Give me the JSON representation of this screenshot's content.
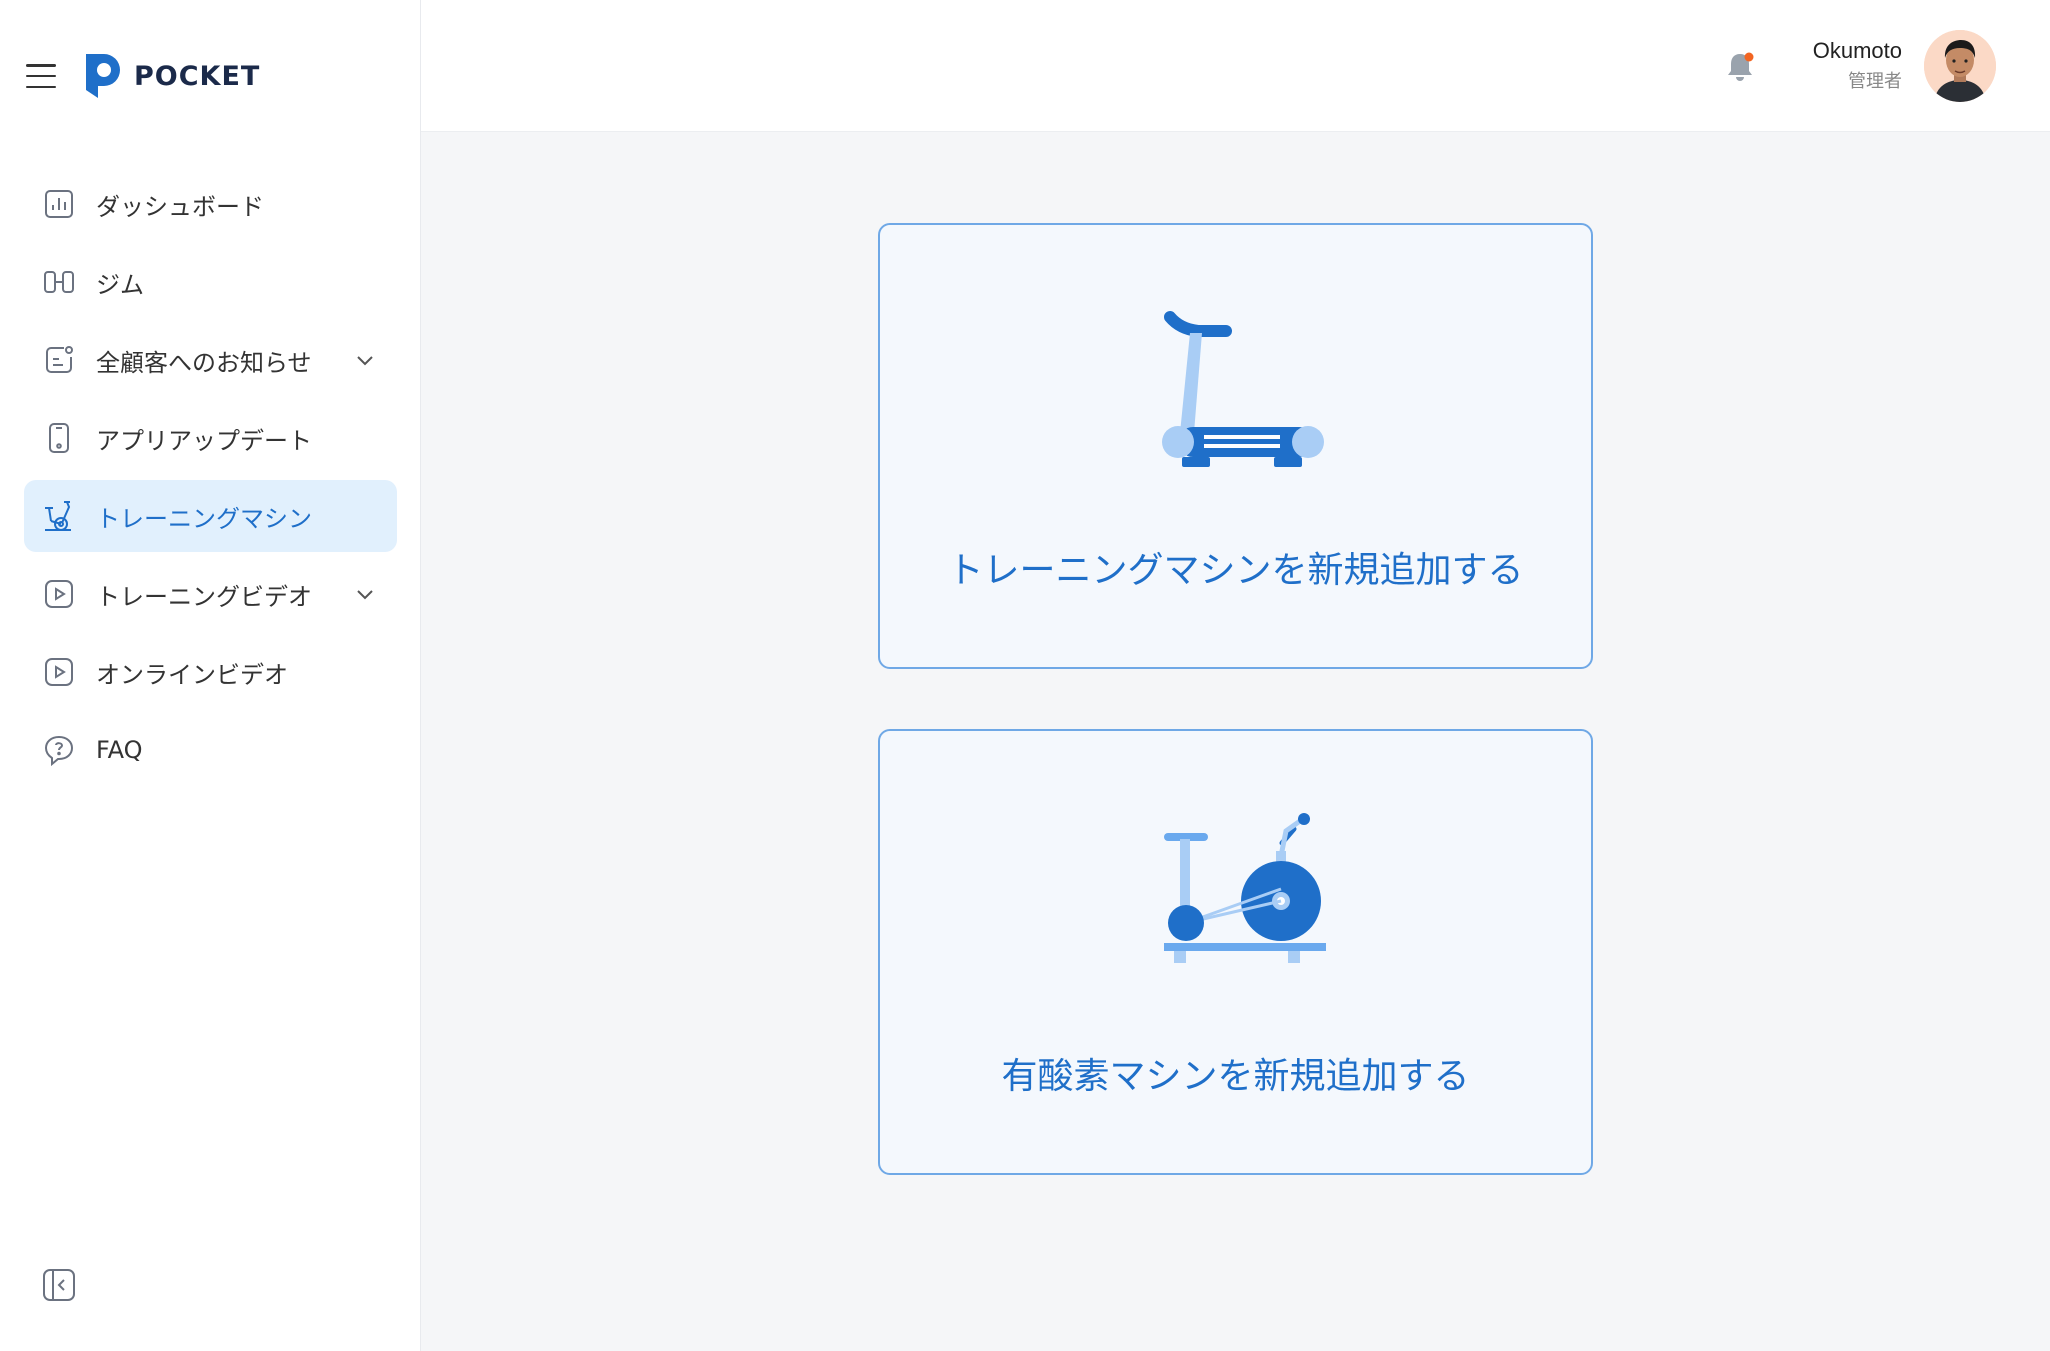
{
  "app": {
    "logo_text": "POCKET",
    "accent_color": "#1f6fc9"
  },
  "sidebar": {
    "items": [
      {
        "label": "ダッシュボード",
        "icon": "chart-icon"
      },
      {
        "label": "ジム",
        "icon": "gym-icon"
      },
      {
        "label": "全顧客へのお知らせ",
        "icon": "announcement-icon",
        "expandable": true
      },
      {
        "label": "アプリアップデート",
        "icon": "phone-icon"
      },
      {
        "label": "トレーニングマシン",
        "icon": "exercise-bike-icon",
        "active": true
      },
      {
        "label": "トレーニングビデオ",
        "icon": "video-icon",
        "expandable": true
      },
      {
        "label": "オンラインビデオ",
        "icon": "video-icon"
      },
      {
        "label": "FAQ",
        "icon": "faq-icon"
      }
    ],
    "collapse_icon": "collapse-sidebar-icon"
  },
  "header": {
    "notification_icon": "bell-icon",
    "user": {
      "name": "Okumoto",
      "role": "管理者"
    }
  },
  "main": {
    "cards": [
      {
        "label": "トレーニングマシンを新規追加する",
        "icon": "treadmill-icon"
      },
      {
        "label": "有酸素マシンを新規追加する",
        "icon": "exercise-bike-icon"
      }
    ]
  }
}
